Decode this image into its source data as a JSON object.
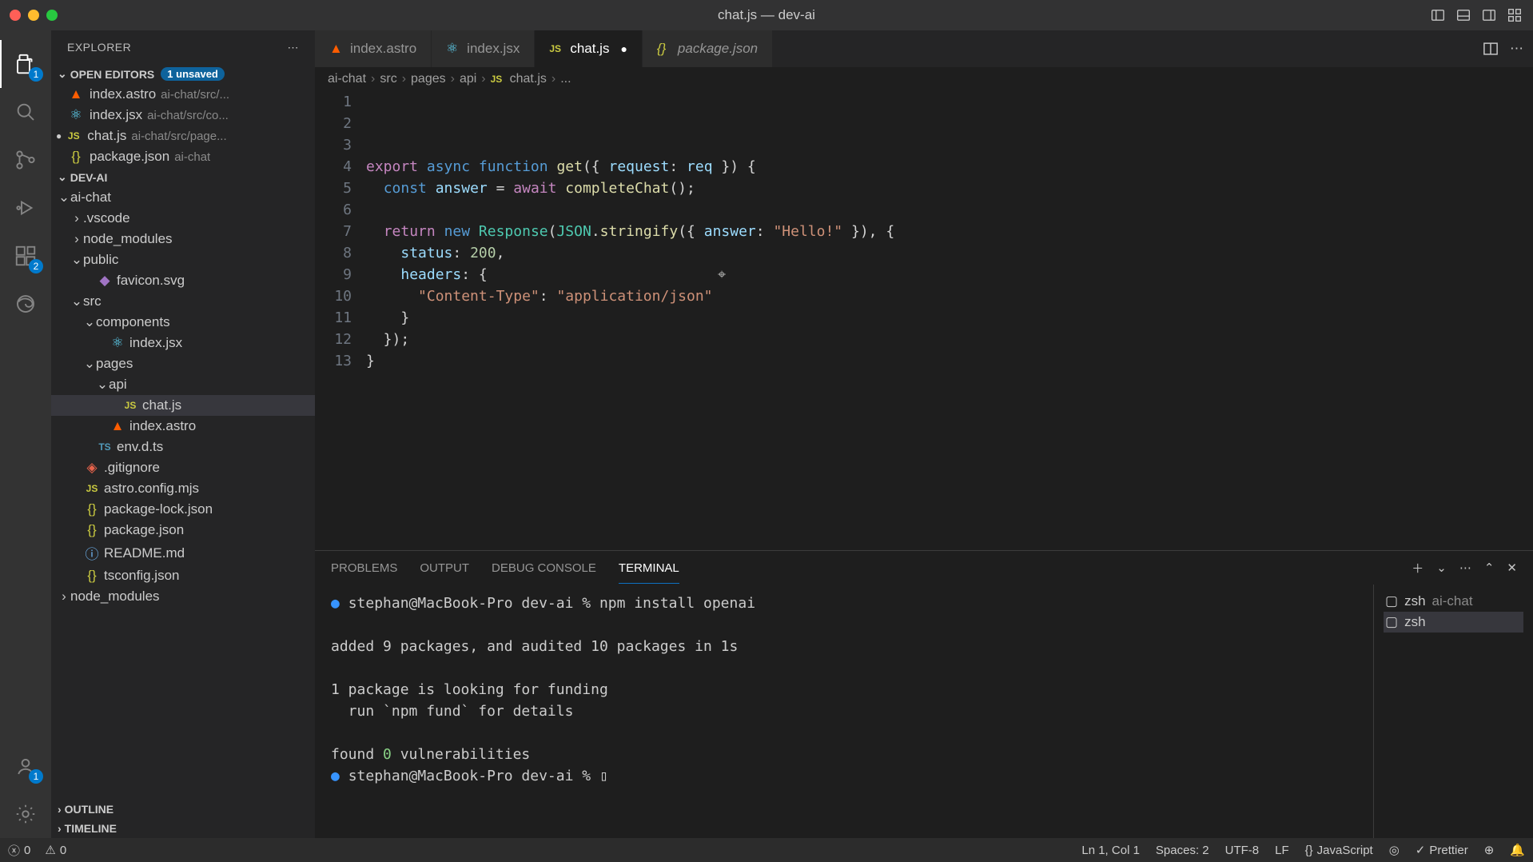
{
  "title": "chat.js — dev-ai",
  "sidebar": {
    "header": "EXPLORER",
    "sections": {
      "open_editors": {
        "title": "OPEN EDITORS",
        "badge": "1 unsaved",
        "items": [
          {
            "name": "index.astro",
            "path": "ai-chat/src/..."
          },
          {
            "name": "index.jsx",
            "path": "ai-chat/src/co..."
          },
          {
            "name": "chat.js",
            "path": "ai-chat/src/page..."
          },
          {
            "name": "package.json",
            "path": "ai-chat"
          }
        ]
      },
      "folder": {
        "title": "DEV-AI",
        "tree": {
          "ai_chat": "ai-chat",
          "vscode": ".vscode",
          "node_modules_inner": "node_modules",
          "public": "public",
          "favicon": "favicon.svg",
          "src": "src",
          "components": "components",
          "index_jsx": "index.jsx",
          "pages": "pages",
          "api": "api",
          "chat_js": "chat.js",
          "index_astro": "index.astro",
          "env_d_ts": "env.d.ts",
          "gitignore": ".gitignore",
          "astro_config": "astro.config.mjs",
          "package_lock": "package-lock.json",
          "package_json": "package.json",
          "readme": "README.md",
          "tsconfig": "tsconfig.json",
          "node_modules_outer": "node_modules"
        }
      },
      "outline": "OUTLINE",
      "timeline": "TIMELINE"
    }
  },
  "tabs": [
    {
      "label": "index.astro"
    },
    {
      "label": "index.jsx"
    },
    {
      "label": "chat.js"
    },
    {
      "label": "package.json"
    }
  ],
  "breadcrumbs": {
    "p0": "ai-chat",
    "p1": "src",
    "p2": "pages",
    "p3": "api",
    "p4": "chat.js",
    "p5": "..."
  },
  "code": {
    "lines": 13
  },
  "panel": {
    "tabs": {
      "problems": "PROBLEMS",
      "output": "OUTPUT",
      "debug": "DEBUG CONSOLE",
      "terminal": "TERMINAL"
    },
    "terminal": {
      "l1_prompt": "stephan@MacBook-Pro dev-ai % ",
      "l1_cmd": "npm install openai",
      "l2": "added 9 packages, and audited 10 packages in 1s",
      "l3": "1 package is looking for funding",
      "l4": "  run `npm fund` for details",
      "l5a": "found ",
      "l5b": "0",
      "l5c": " vulnerabilities",
      "l6": "stephan@MacBook-Pro dev-ai % "
    },
    "terminals": [
      {
        "name": "zsh",
        "dir": "ai-chat"
      },
      {
        "name": "zsh",
        "dir": ""
      }
    ]
  },
  "status": {
    "errors": "0",
    "warnings": "0",
    "position": "Ln 1, Col 1",
    "spaces": "Spaces: 2",
    "encoding": "UTF-8",
    "eol": "LF",
    "language": "JavaScript",
    "prettier": "Prettier"
  },
  "activitybar": {
    "explorer_badge": "1",
    "extensions_badge": "2",
    "account_badge": "1"
  }
}
